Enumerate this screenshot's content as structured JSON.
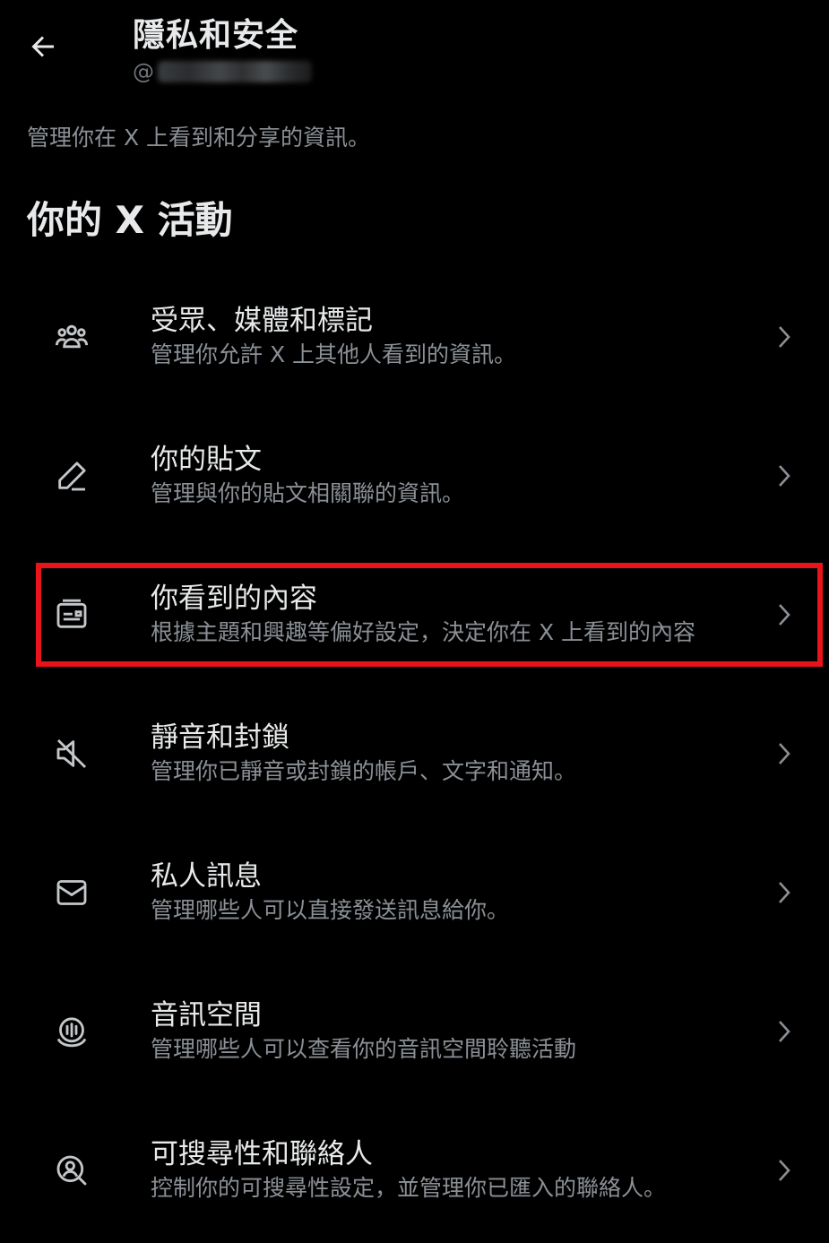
{
  "header": {
    "title": "隱私和安全",
    "handle_prefix": "@",
    "back_icon": "arrow-left-icon"
  },
  "intro": "管理你在 X 上看到和分享的資訊。",
  "section_title": "你的 X 活動",
  "menu": [
    {
      "label": "受眾、媒體和標記",
      "desc": "管理你允許 X 上其他人看到的資訊。",
      "icon": "people-icon"
    },
    {
      "label": "你的貼文",
      "desc": "管理與你的貼文相關聯的資訊。",
      "icon": "pencil-icon"
    },
    {
      "label": "你看到的內容",
      "desc": "根據主題和興趣等偏好設定，決定你在 X 上看到的內容",
      "icon": "content-card-icon"
    },
    {
      "label": "靜音和封鎖",
      "desc": "管理你已靜音或封鎖的帳戶、文字和通知。",
      "icon": "mute-icon"
    },
    {
      "label": "私人訊息",
      "desc": "管理哪些人可以直接發送訊息給你。",
      "icon": "envelope-icon"
    },
    {
      "label": "音訊空間",
      "desc": "管理哪些人可以查看你的音訊空間聆聽活動",
      "icon": "spaces-icon"
    },
    {
      "label": "可搜尋性和聯絡人",
      "desc": "控制你的可搜尋性設定，並管理你已匯入的聯絡人。",
      "icon": "search-person-icon"
    }
  ],
  "colors": {
    "background": "#000000",
    "primary_text": "#e7e9ea",
    "secondary_text": "#8b9096",
    "highlight_border": "#e8141a"
  }
}
